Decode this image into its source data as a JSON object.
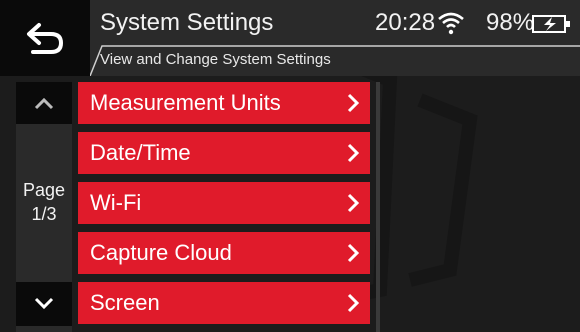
{
  "header": {
    "title": "System Settings",
    "subtitle": "View and Change System Settings",
    "time": "20:28",
    "battery": "98%"
  },
  "nav": {
    "page_label_line1": "Page",
    "page_label_line2": "1/3"
  },
  "menu": {
    "items": [
      {
        "label": "Measurement Units"
      },
      {
        "label": "Date/Time"
      },
      {
        "label": "Wi-Fi"
      },
      {
        "label": "Capture Cloud"
      },
      {
        "label": "Screen"
      }
    ]
  },
  "colors": {
    "accent": "#e01b2b",
    "header_bg": "#2a2a2a",
    "button_bg": "#0a0a0a",
    "background": "#1c1c1c"
  },
  "icons": {
    "back": "back-arrow-icon",
    "wifi": "wifi-icon",
    "battery": "battery-charging-icon",
    "up": "chevron-up-icon",
    "down": "chevron-down-icon",
    "item": "chevron-right-icon"
  }
}
